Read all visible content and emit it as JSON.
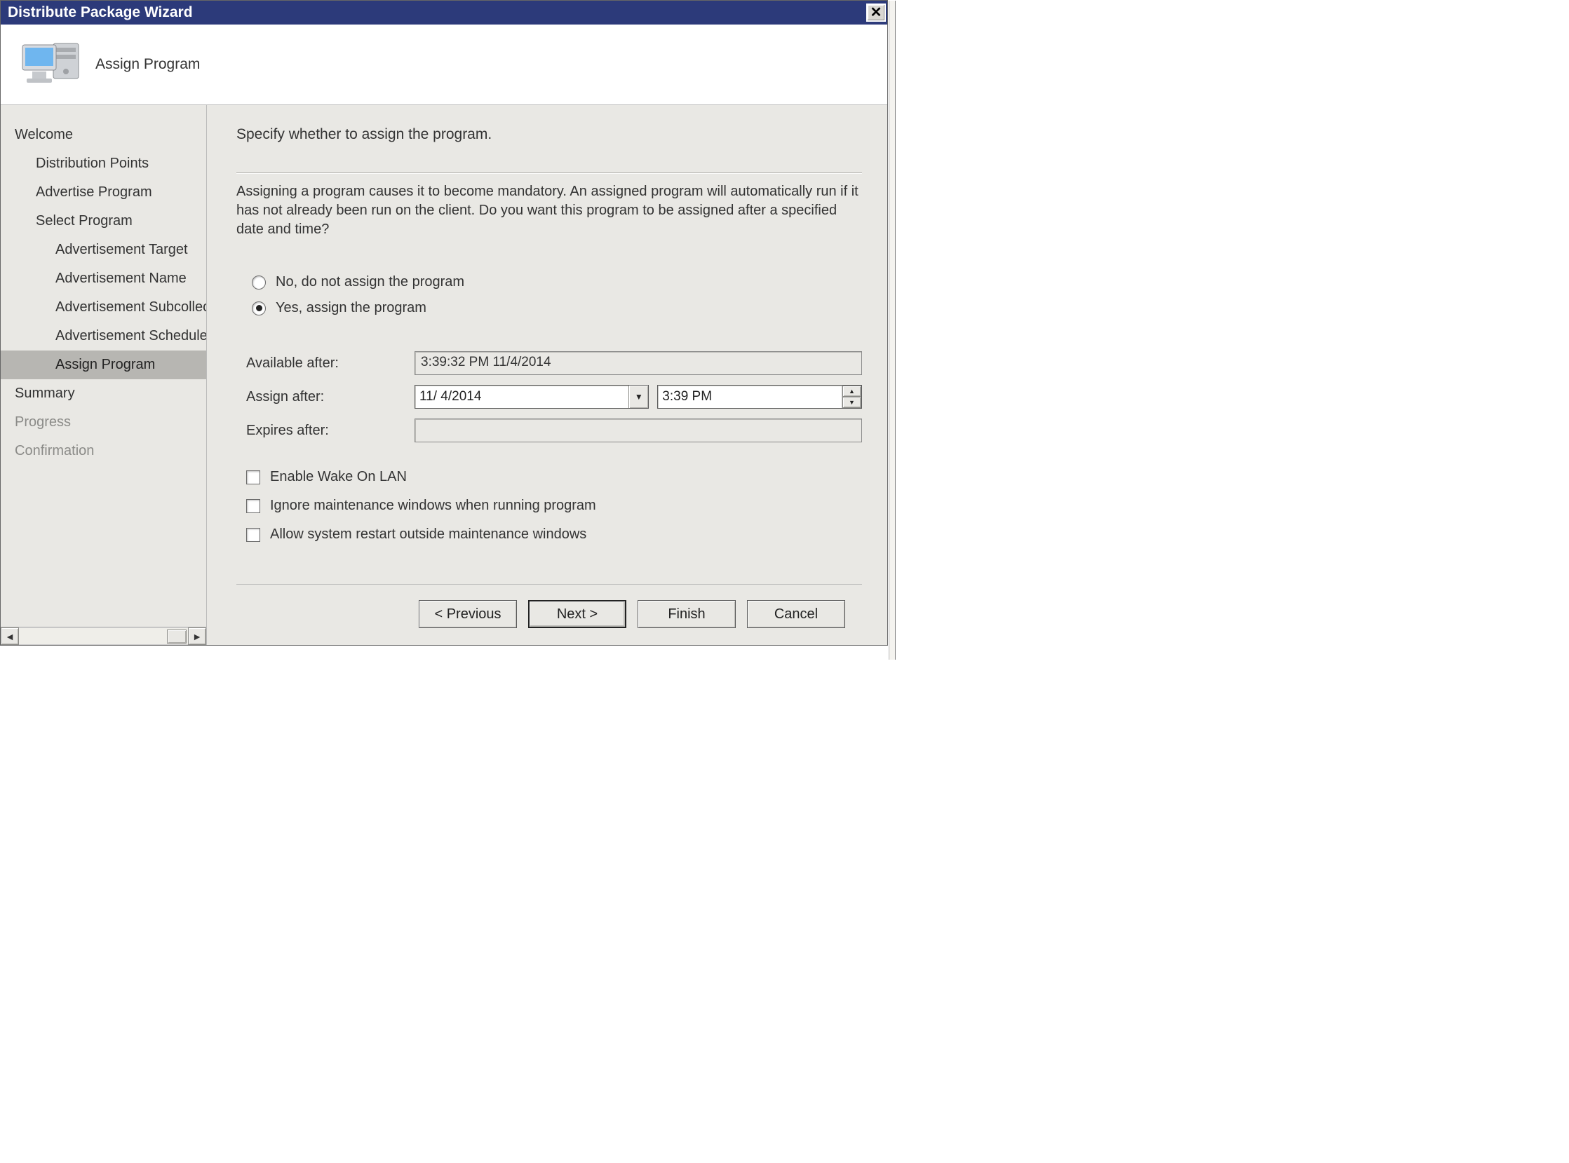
{
  "window": {
    "title": "Distribute Package Wizard"
  },
  "banner": {
    "page_title": "Assign Program"
  },
  "nav": {
    "items": [
      {
        "label": "Welcome",
        "level": 0,
        "selected": false,
        "dim": false
      },
      {
        "label": "Distribution Points",
        "level": 1,
        "selected": false,
        "dim": false
      },
      {
        "label": "Advertise Program",
        "level": 1,
        "selected": false,
        "dim": false
      },
      {
        "label": "Select Program",
        "level": 1,
        "selected": false,
        "dim": false
      },
      {
        "label": "Advertisement Target",
        "level": 2,
        "selected": false,
        "dim": false
      },
      {
        "label": "Advertisement Name",
        "level": 2,
        "selected": false,
        "dim": false
      },
      {
        "label": "Advertisement Subcollec",
        "level": 2,
        "selected": false,
        "dim": false
      },
      {
        "label": "Advertisement Schedule",
        "level": 2,
        "selected": false,
        "dim": false
      },
      {
        "label": "Assign Program",
        "level": 2,
        "selected": true,
        "dim": false
      },
      {
        "label": "Summary",
        "level": 0,
        "selected": false,
        "dim": false
      },
      {
        "label": "Progress",
        "level": 0,
        "selected": false,
        "dim": true
      },
      {
        "label": "Confirmation",
        "level": 0,
        "selected": false,
        "dim": true
      }
    ]
  },
  "content": {
    "instruction": "Specify whether to assign the program.",
    "description": "Assigning a program causes it to become mandatory. An assigned program will automatically run if it has not already been run on the client. Do you want this program to be assigned after a specified date and time?",
    "radios": {
      "no_label": "No, do not assign the program",
      "yes_label": "Yes, assign the program",
      "selected": "yes"
    },
    "fields": {
      "available_label": "Available after:",
      "available_value": "3:39:32 PM 11/4/2014",
      "assign_label": "Assign after:",
      "assign_date": "11/  4/2014",
      "assign_time": " 3:39 PM",
      "expires_label": "Expires after:",
      "expires_value": ""
    },
    "checkboxes": {
      "wol": "Enable Wake On LAN",
      "ignore": "Ignore maintenance windows when running program",
      "restart": "Allow system restart outside maintenance windows"
    }
  },
  "buttons": {
    "previous": "< Previous",
    "next": "Next >",
    "finish": "Finish",
    "cancel": "Cancel"
  }
}
